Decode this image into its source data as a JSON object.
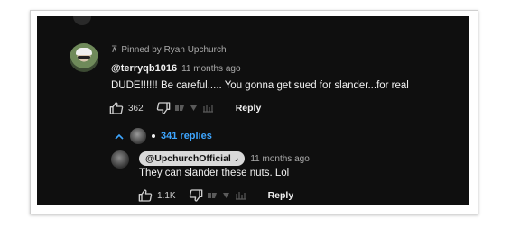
{
  "pinned": {
    "text": "Pinned by Ryan Upchurch"
  },
  "comment": {
    "author": "@terryqb1016",
    "time": "11 months ago",
    "text": "DUDE!!!!!! Be careful..... You gonna get sued for slander...for real",
    "likes": "362",
    "reply_label": "Reply"
  },
  "replies_toggle": {
    "label": "341 replies"
  },
  "reply": {
    "author": "@UpchurchOfficial",
    "time": "11 months ago",
    "text": "They can slander these nuts. Lol",
    "likes": "1.1K",
    "reply_label": "Reply"
  },
  "colors": {
    "background": "#0f0f0f",
    "link": "#3ea6ff",
    "text": "#f1f1f1",
    "muted": "#aaaaaa"
  },
  "icons": [
    "pin-icon",
    "thumb-up-icon",
    "thumb-down-icon",
    "chevron-up-icon",
    "music-note-icon"
  ]
}
